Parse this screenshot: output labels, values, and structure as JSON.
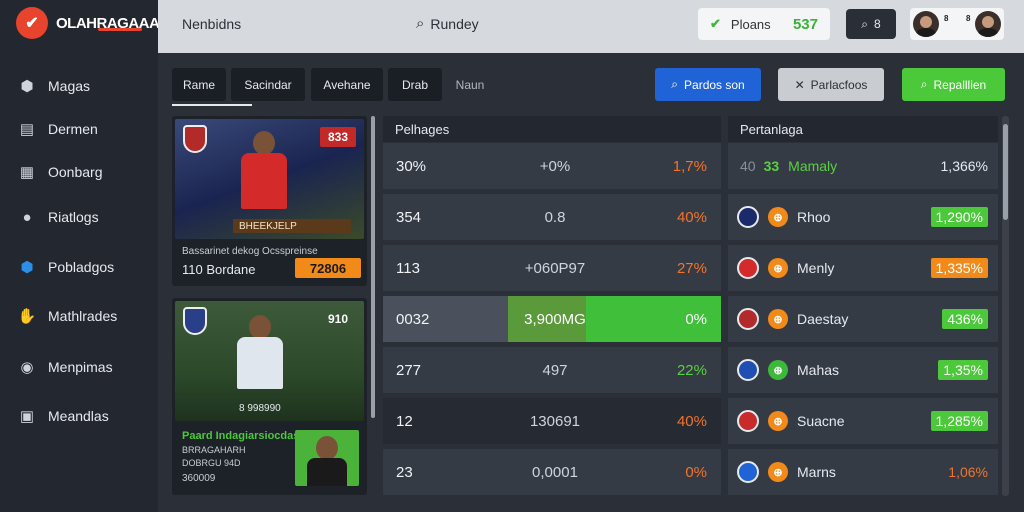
{
  "brand": {
    "name": "OLAHRAGAAA"
  },
  "sidebar": {
    "items": [
      {
        "label": "Magas",
        "icon": "ball-icon"
      },
      {
        "label": "Dermen",
        "icon": "document-icon"
      },
      {
        "label": "Oonbarg",
        "icon": "calendar-icon"
      },
      {
        "label": "Riatlogs",
        "icon": "user-icon"
      },
      {
        "label": "Pobladgos",
        "icon": "shield-icon"
      },
      {
        "label": "Mathlrades",
        "icon": "handshake-icon"
      },
      {
        "label": "Menpimas",
        "icon": "gamepad-icon"
      },
      {
        "label": "Meandlas",
        "icon": "wallet-icon"
      }
    ]
  },
  "header": {
    "link": "Nenbidns",
    "search_label": "Rundey",
    "score_label": "Ploans",
    "score_value": "537",
    "search_button": "8",
    "profile_a": "8",
    "profile_b": "8"
  },
  "tabs": [
    "Rame",
    "Sacindar",
    "Avehane",
    "Drab",
    "Naun"
  ],
  "actions": {
    "primary": "Pardos son",
    "secondary": "Parlacfoos",
    "success": "Repalllien"
  },
  "cards": [
    {
      "price": "833",
      "band": "BHEEKJELP",
      "meta": "Bassarinet dekog Ocsspreinse",
      "stat": "110 Bordane",
      "pill": "72806"
    },
    {
      "price": "910",
      "band": "8 998990",
      "title": "Paard Indagiarsiocdas",
      "sub": "BRRAGAHARH",
      "sub2": "DOBRGU 94D",
      "stat": "360009"
    }
  ],
  "stats": {
    "title": "Pelhages",
    "rows": [
      {
        "a": "30%",
        "b": "+0%",
        "c": "1,7%",
        "tone": "orange"
      },
      {
        "a": "354",
        "b": "0.8",
        "c": "40%",
        "tone": "orange"
      },
      {
        "a": "113",
        "b": "+060P97",
        "c": "27%",
        "tone": "orange"
      },
      {
        "a": "0032",
        "b": "3,900MG",
        "c": "0%",
        "tone": "white"
      },
      {
        "a": "277",
        "b": "497",
        "c": "22%",
        "tone": "green"
      },
      {
        "a": "12",
        "b": "130691",
        "c": "40%",
        "tone": "orange"
      },
      {
        "a": "23",
        "b": "0,0001",
        "c": "0%",
        "tone": "orange"
      }
    ]
  },
  "list": {
    "title": "Pertanlaga",
    "rows": [
      {
        "rank": "40",
        "score": "33",
        "name": "Mamaly",
        "value": "1,366%",
        "style": "plain"
      },
      {
        "name": "Rhoo",
        "value": "1,290%",
        "style": "green"
      },
      {
        "name": "Menly",
        "value": "1,335%",
        "style": "orange"
      },
      {
        "name": "Daestay",
        "value": "436%",
        "style": "green"
      },
      {
        "name": "Mahas",
        "value": "1,35%",
        "style": "green"
      },
      {
        "name": "Suacne",
        "value": "1,285%",
        "style": "green"
      },
      {
        "name": "Marns",
        "value": "1,06%",
        "style": "orange-text"
      }
    ]
  },
  "colors": {
    "primary": "#1f63d6",
    "success": "#4cc93a",
    "accent": "#f2742a"
  }
}
